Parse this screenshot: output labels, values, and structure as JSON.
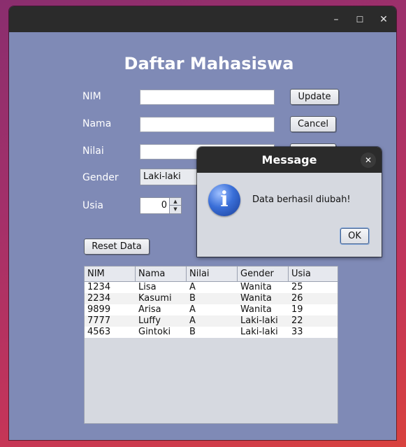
{
  "window": {
    "controls": {
      "minimize": "–",
      "maximize": "☐",
      "close": "✕"
    }
  },
  "form": {
    "title": "Daftar Mahasiswa",
    "labels": {
      "nim": "NIM",
      "nama": "Nama",
      "nilai": "Nilai",
      "gender": "Gender",
      "usia": "Usia"
    },
    "values": {
      "nim": "",
      "nama": "",
      "nilai": "",
      "gender": "Laki-laki",
      "usia": "0"
    },
    "buttons": {
      "update": "Update",
      "cancel": "Cancel",
      "reset": "Reset Data"
    }
  },
  "table": {
    "columns": [
      "NIM",
      "Nama",
      "Nilai",
      "Gender",
      "Usia"
    ],
    "rows": [
      [
        "1234",
        "Lisa",
        "A",
        "Wanita",
        "25"
      ],
      [
        "2234",
        "Kasumi",
        "B",
        "Wanita",
        "26"
      ],
      [
        "9899",
        "Arisa",
        "A",
        "Wanita",
        "19"
      ],
      [
        "7777",
        "Luffy",
        "A",
        "Laki-laki",
        "22"
      ],
      [
        "4563",
        "Gintoki",
        "B",
        "Laki-laki",
        "33"
      ]
    ]
  },
  "dialog": {
    "title": "Message",
    "icon": "info-icon",
    "icon_glyph": "i",
    "close_glyph": "✕",
    "message": "Data berhasil diubah!",
    "ok_label": "OK"
  },
  "colors": {
    "window_bg": "#7f8ab6",
    "titlebar": "#2b2b2b",
    "dialog_bg": "#d6d9e0"
  }
}
